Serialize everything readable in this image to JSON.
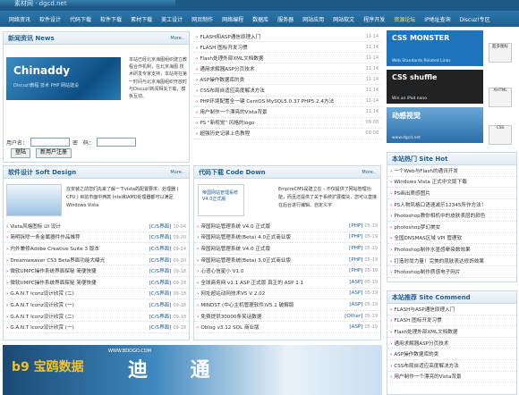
{
  "header": {
    "logo_text": "素材网 · dgcd.net"
  },
  "nav": [
    "网络资讯",
    "软件设计",
    "代码下载",
    "软件下载",
    "素材下载",
    "美工设计",
    "网页制作",
    "网络编程",
    "数据库",
    "服务器",
    "网站应用",
    "网站软文",
    "程序开发",
    "资源论坛",
    "IP地址查询",
    "Discuz!专区"
  ],
  "news": {
    "title": "新闻资讯 News",
    "more": "More..",
    "logo_text": "Chinaddy",
    "logo_sub": "Discuz!教程 技术 PHP 网站建设",
    "desc": "本站已经北京海图组织建立教程合作机制，在北京海图 技术研发专家支持，本站将在第一时间与北京海图组织开放时与Discuz!新闻相关下载，模板互动。",
    "user_label": "用户名：",
    "pass_label": "密　码：",
    "login_btn": "登陆",
    "register_btn": "新用户注册"
  },
  "latest": [
    {
      "t": "FLASH和ASP通信原理入门",
      "d": "11-14"
    },
    {
      "t": "FLASH 图标开发习惯",
      "d": "11-14"
    },
    {
      "t": "Flash处理外部XML文档数据",
      "d": "11-14"
    },
    {
      "t": "通用求解器ASP分页技术",
      "d": "11-14"
    },
    {
      "t": "ASP操作数据库的类",
      "d": "11-14"
    },
    {
      "t": "CSS布局自适应高度解决方法",
      "d": "11-14"
    },
    {
      "t": "PHP环境配置全一键 CentOS MySQL5.0.37 PHP5.2.4方法",
      "d": "11-14"
    },
    {
      "t": "用户制作一个漂亮的Vista背景",
      "d": "11-14"
    },
    {
      "t": "PS \"新视觉\" 风格的logo",
      "d": "09-08"
    },
    {
      "t": "超强历史记录上色教程",
      "d": "09-08"
    }
  ],
  "ads": {
    "monster_title": "CSS MONSTER",
    "monster_sub": "Web Standards Related Links",
    "shuffle_title": "CSS shuffle",
    "shuffle_sub": "Win an iPod nano",
    "animation_title": "动感视觉",
    "animation_sub": "www.dgcd.net",
    "side1": "超多图标",
    "side2": "XHTML",
    "side3": "CSS"
  },
  "soft": {
    "title": "软件设计 Soft Design",
    "more": "More..",
    "intro": "在安装之前您们先来了解一下vista的配置要求：处理器 ( CPU ) 目前市面中两款 Intel和AMD处理器都可以满足Windows Vista",
    "items": [
      {
        "t": "Vista风格图标 UI 设计",
        "tag": "[C/S界面]",
        "d": "10-04"
      },
      {
        "t": "简明拆除一条金属器件作品推荐",
        "tag": "[C/S界面]",
        "d": "09-20"
      },
      {
        "t": "内外兼修Adobe Creative Suite 3 版本 ",
        "tag": "[C/S界面]",
        "d": "09-24"
      },
      {
        "t": "Dreamweaver CS3 Beta界面功能大曝光",
        "tag": "[C/S界面]",
        "d": "09-20"
      },
      {
        "t": "微软UMPC操作系统界面探秘 简便快捷",
        "tag": "[C/S界面]",
        "d": "09-18"
      },
      {
        "t": "微软UMPC操作系统界面探秘 简便快捷",
        "tag": "[C/S界面]",
        "d": "09-18"
      },
      {
        "t": "G.A.N.T Iconz设计欣赏 (二)",
        "tag": "[C/S界面]",
        "d": "09-18"
      },
      {
        "t": "G.A.N.T Iconz设计欣赏 (一)",
        "tag": "[C/S界面]",
        "d": "09-18"
      },
      {
        "t": "G.A.N.T Iconz设计欣赏 (二)",
        "tag": "[C/S界面]",
        "d": "09-18"
      },
      {
        "t": "G.A.N.T Iconz设计欣赏 (一)",
        "tag": "[C/S界面]",
        "d": "09-18"
      }
    ]
  },
  "code": {
    "title": "代码下载 Code Down",
    "more": "More..",
    "thumb_text": "帝国网站管理系统 V4.0正式版",
    "intro": "EmpireCMS是建立在 - 不仅提供了网站管理功能，而且还提供了关于系统扩展模块，您可以直接在后台进行编辑、自定义字",
    "items": [
      {
        "t": "帝国网站管理系统 V4.0 正式版",
        "tag": "[PHP]",
        "d": "05-19"
      },
      {
        "t": "帝国网站管理系统(Beta) 4.0正式商业版",
        "tag": "[PHP]",
        "d": "05-19"
      },
      {
        "t": "帝国网站管理系统 V4.0 正式版",
        "tag": "[PHP]",
        "d": "05-19"
      },
      {
        "t": "帝国网站管理系统(Beta) 3.0正式商业版",
        "tag": "[PHP]",
        "d": "05-19"
      },
      {
        "t": "心语心信星小 V1.0",
        "tag": "[PHP]",
        "d": "05-19"
      },
      {
        "t": "全球商务网 v1.1 ASP 正式版 真正的 ASP 1.1",
        "tag": "[ASP]",
        "d": "05-19"
      },
      {
        "t": "网址超站动网技术V5 V 2.02",
        "tag": "[ASP]",
        "d": "05-19"
      },
      {
        "t": "MINDST (中心主机管理软件)V5.1 破解版",
        "tag": "[ASP]",
        "d": "05-19"
      },
      {
        "t": "免费提供30000条笑话数据",
        "tag": "[Other]",
        "d": "05-19"
      },
      {
        "t": "Oblog v3.12 SQL 商业版",
        "tag": "[ASP]",
        "d": "05-19"
      }
    ]
  },
  "hot": {
    "title": "本站热门 Site Hot",
    "items": [
      "一个Web与Flash的通讯开发",
      "Windows Vista 正式中文版下载",
      "PS画出质感图片",
      "PS人物风格口语速减乐12345所作方法！",
      "Photoshop教你相机中的皮肤表层的颜色",
      "photoshop梦幻美女",
      "全国DNSMAS区域 VPI 管理软",
      "Photoshop制作水墨感晕染数效果",
      "打造时尚力量！完美的肌肤表达修饰效果",
      "Photoshop制作质感电子网片"
    ]
  },
  "recommend": {
    "title": "本站推荐 Site Commend",
    "items": [
      "FLASH与ASP通信原理入门",
      "FLASH 图标开发习惯",
      "Flash处理外部XML文档数据",
      "通用求解器ASP分页技术",
      "ASP操作数据库的类",
      "CSS布局自适应高度解决方法",
      "用户制作一个漂亮的Vista背景"
    ]
  },
  "banner": {
    "logo": "b9 宝鸥数据",
    "url": "WWW.BDOGO.COM",
    "big": "迪 通 "
  }
}
